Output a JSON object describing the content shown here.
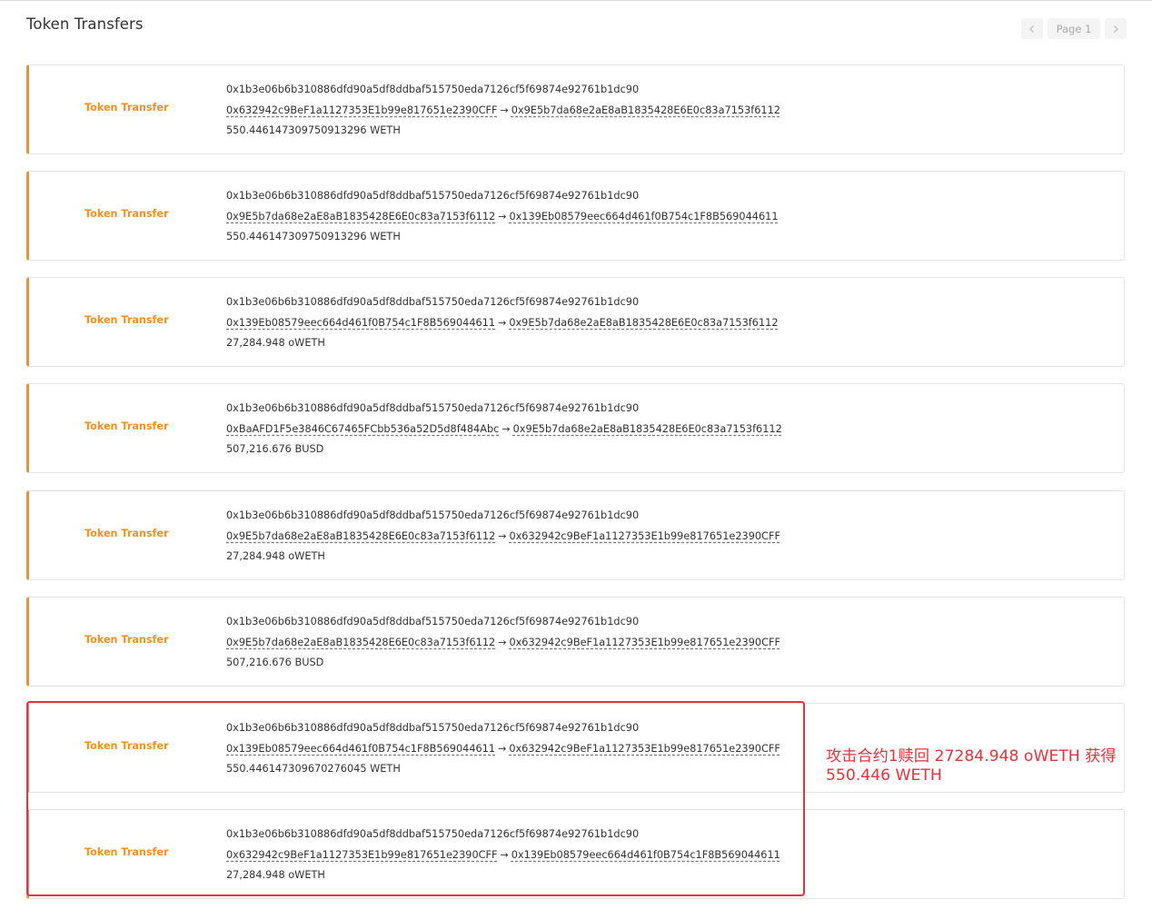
{
  "header": {
    "title": "Token Transfers",
    "page_label": "Page 1"
  },
  "transfers": [
    {
      "type": "Token Transfer",
      "tx_hash": "0x1b3e06b6b310886dfd90a5df8ddbaf515750eda7126cf5f69874e92761b1dc90",
      "from": "0x632942c9BeF1a1127353E1b99e817651e2390CFF",
      "to": "0x9E5b7da68e2aE8aB1835428E6E0c83a7153f6112",
      "amount": "550.446147309750913296 WETH"
    },
    {
      "type": "Token Transfer",
      "tx_hash": "0x1b3e06b6b310886dfd90a5df8ddbaf515750eda7126cf5f69874e92761b1dc90",
      "from": "0x9E5b7da68e2aE8aB1835428E6E0c83a7153f6112",
      "to": "0x139Eb08579eec664d461f0B754c1F8B569044611",
      "amount": "550.446147309750913296 WETH"
    },
    {
      "type": "Token Transfer",
      "tx_hash": "0x1b3e06b6b310886dfd90a5df8ddbaf515750eda7126cf5f69874e92761b1dc90",
      "from": "0x139Eb08579eec664d461f0B754c1F8B569044611",
      "to": "0x9E5b7da68e2aE8aB1835428E6E0c83a7153f6112",
      "amount": "27,284.948 oWETH"
    },
    {
      "type": "Token Transfer",
      "tx_hash": "0x1b3e06b6b310886dfd90a5df8ddbaf515750eda7126cf5f69874e92761b1dc90",
      "from": "0xBaAFD1F5e3846C67465FCbb536a52D5d8f484Abc",
      "to": "0x9E5b7da68e2aE8aB1835428E6E0c83a7153f6112",
      "amount": "507,216.676 BUSD"
    },
    {
      "type": "Token Transfer",
      "tx_hash": "0x1b3e06b6b310886dfd90a5df8ddbaf515750eda7126cf5f69874e92761b1dc90",
      "from": "0x9E5b7da68e2aE8aB1835428E6E0c83a7153f6112",
      "to": "0x632942c9BeF1a1127353E1b99e817651e2390CFF",
      "amount": "27,284.948 oWETH"
    },
    {
      "type": "Token Transfer",
      "tx_hash": "0x1b3e06b6b310886dfd90a5df8ddbaf515750eda7126cf5f69874e92761b1dc90",
      "from": "0x9E5b7da68e2aE8aB1835428E6E0c83a7153f6112",
      "to": "0x632942c9BeF1a1127353E1b99e817651e2390CFF",
      "amount": "507,216.676 BUSD"
    },
    {
      "type": "Token Transfer",
      "tx_hash": "0x1b3e06b6b310886dfd90a5df8ddbaf515750eda7126cf5f69874e92761b1dc90",
      "from": "0x139Eb08579eec664d461f0B754c1F8B569044611",
      "to": "0x632942c9BeF1a1127353E1b99e817651e2390CFF",
      "amount": "550.446147309670276045 WETH"
    },
    {
      "type": "Token Transfer",
      "tx_hash": "0x1b3e06b6b310886dfd90a5df8ddbaf515750eda7126cf5f69874e92761b1dc90",
      "from": "0x632942c9BeF1a1127353E1b99e817651e2390CFF",
      "to": "0x139Eb08579eec664d461f0B754c1F8B569044611",
      "amount": "27,284.948 oWETH"
    }
  ],
  "annotation": {
    "text_line1": "攻击合约1赎回 27284.948 oWETH 获得",
    "text_line2": "550.446 WETH",
    "color": "#e8323c"
  },
  "colors": {
    "accent": "#f6911e",
    "highlight": "#e8323c"
  }
}
